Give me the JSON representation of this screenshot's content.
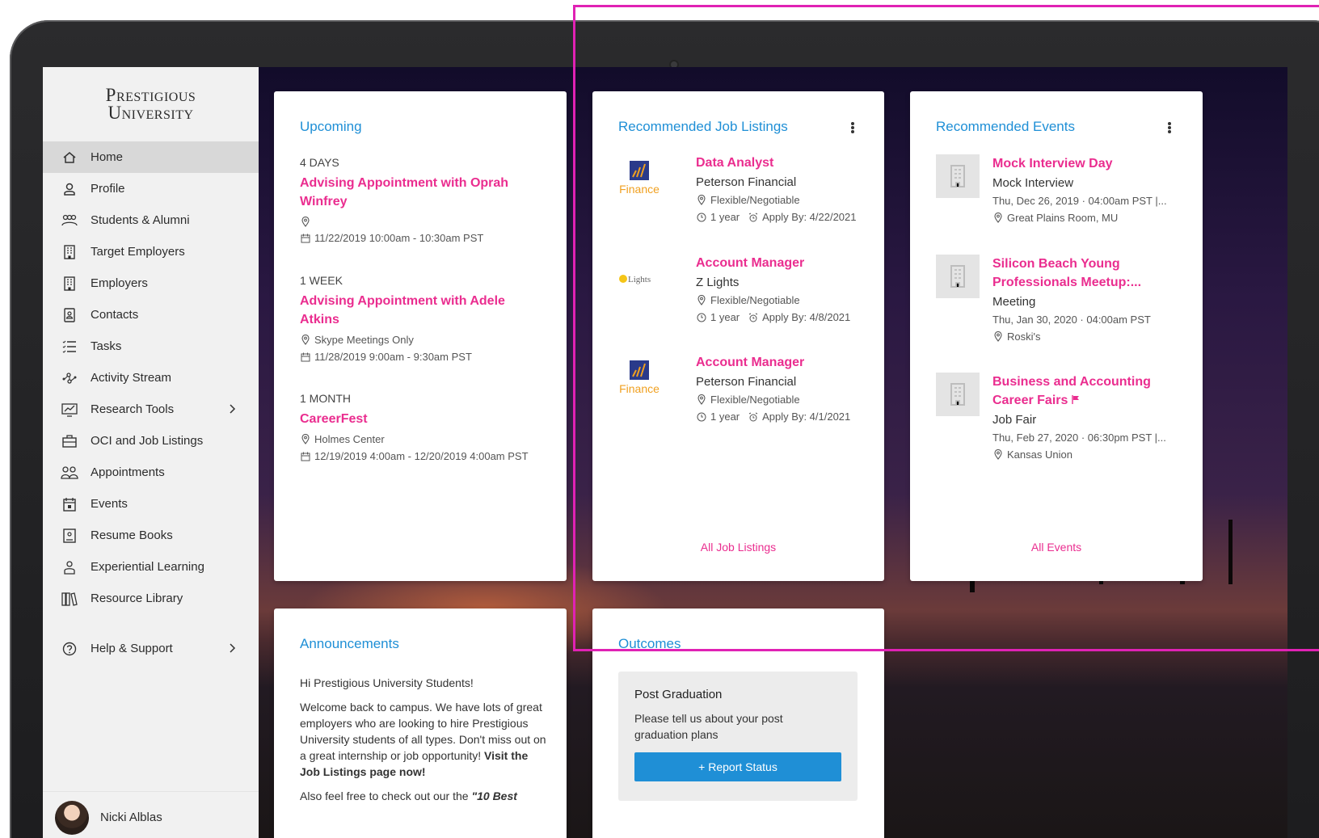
{
  "brand": {
    "line1": "Prestigious",
    "line2": "University"
  },
  "sidebar": {
    "items": [
      {
        "label": "Home",
        "icon": "home-icon",
        "active": true
      },
      {
        "label": "Profile",
        "icon": "user-icon"
      },
      {
        "label": "Students & Alumni",
        "icon": "users-icon"
      },
      {
        "label": "Target Employers",
        "icon": "building-icon"
      },
      {
        "label": "Employers",
        "icon": "building-icon"
      },
      {
        "label": "Contacts",
        "icon": "contact-card-icon"
      },
      {
        "label": "Tasks",
        "icon": "checklist-icon"
      },
      {
        "label": "Activity Stream",
        "icon": "activity-icon"
      },
      {
        "label": "Research Tools",
        "icon": "chart-icon",
        "chevron": true
      },
      {
        "label": "OCI and Job Listings",
        "icon": "briefcase-icon"
      },
      {
        "label": "Appointments",
        "icon": "people-icon"
      },
      {
        "label": "Events",
        "icon": "calendar-icon"
      },
      {
        "label": "Resume Books",
        "icon": "book-icon"
      },
      {
        "label": "Experiential Learning",
        "icon": "learning-icon"
      },
      {
        "label": "Resource Library",
        "icon": "library-icon"
      }
    ],
    "help": {
      "label": "Help & Support",
      "icon": "help-icon"
    },
    "user": {
      "name": "Nicki Alblas"
    }
  },
  "upcoming": {
    "title": "Upcoming",
    "items": [
      {
        "when": "4 DAYS",
        "title": "Advising Appointment with Oprah Winfrey",
        "location": "",
        "datetime": "11/22/2019 10:00am - 10:30am PST"
      },
      {
        "when": "1 WEEK",
        "title": "Advising Appointment with Adele Atkins",
        "location": "Skype Meetings Only",
        "datetime": "11/28/2019 9:00am - 9:30am PST"
      },
      {
        "when": "1 MONTH",
        "title": "CareerFest",
        "location": "Holmes Center",
        "datetime": "12/19/2019 4:00am - 12/20/2019 4:00am PST"
      }
    ]
  },
  "jobs": {
    "title": "Recommended Job Listings",
    "items": [
      {
        "title": "Data Analyst",
        "company": "Peterson Financial",
        "logo_text": "Finance",
        "location": "Flexible/Negotiable",
        "duration": "1 year",
        "apply": "Apply By: 4/22/2021"
      },
      {
        "title": "Account Manager",
        "company": "Z Lights",
        "logo_text": "Lights",
        "location": "Flexible/Negotiable",
        "duration": "1 year",
        "apply": "Apply By: 4/8/2021"
      },
      {
        "title": "Account Manager",
        "company": "Peterson Financial",
        "logo_text": "Finance",
        "location": "Flexible/Negotiable",
        "duration": "1 year",
        "apply": "Apply By: 4/1/2021"
      }
    ],
    "link": "All Job Listings"
  },
  "events": {
    "title": "Recommended Events",
    "items": [
      {
        "title": "Mock Interview Day",
        "type": "Mock Interview",
        "datetime": "Thu, Dec 26, 2019 · 04:00am PST  |...",
        "location": "Great Plains Room, MU"
      },
      {
        "title": "Silicon Beach Young Professionals Meetup:...",
        "type": "Meeting",
        "datetime": "Thu, Jan 30, 2020 · 04:00am PST",
        "location": "Roski's"
      },
      {
        "title": "Business and Accounting Career Fairs",
        "type": "Job Fair",
        "datetime": "Thu, Feb 27, 2020 · 06:30pm PST  |...",
        "location": "Kansas Union"
      }
    ],
    "link": "All Events"
  },
  "announcements": {
    "title": "Announcements",
    "greeting": "Hi Prestigious University Students!",
    "body": "Welcome back to campus. We have lots of great employers who are looking to hire Prestigious University students of all types. Don't miss out on a great internship or job opportunity!",
    "body_bold": "Visit the Job Listings page now!",
    "body2": "Also feel free to check out our the",
    "body2_bold": "\"10 Best"
  },
  "outcomes": {
    "title": "Outcomes",
    "heading": "Post Graduation",
    "prompt": "Please tell us about your post graduation plans",
    "button": "+ Report Status"
  },
  "colors": {
    "accent": "#1f8fd6",
    "link": "#ea2d8f",
    "highlight": "#e022b4"
  }
}
